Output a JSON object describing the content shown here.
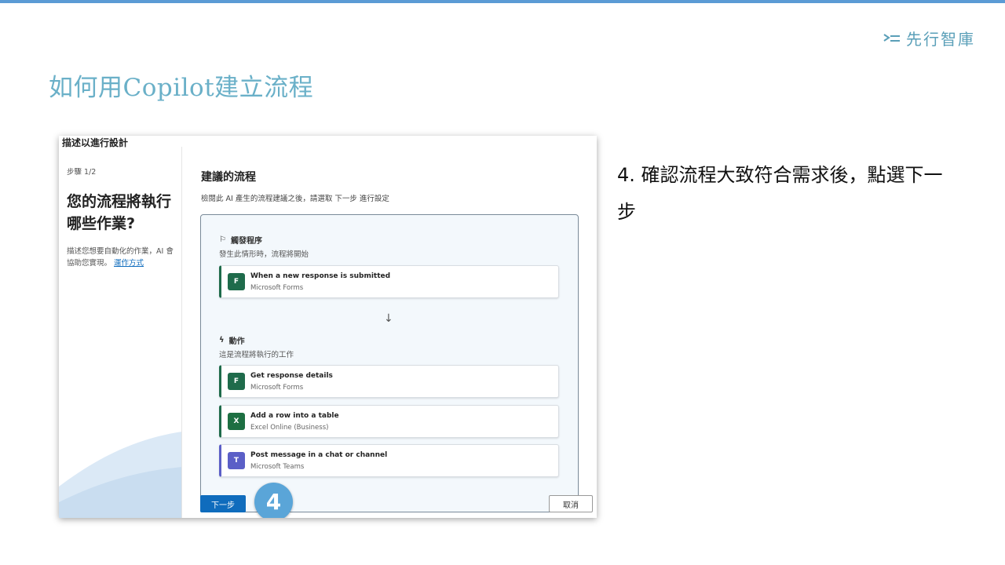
{
  "brand": {
    "name": "先行智庫"
  },
  "slide": {
    "title": "如何用Copilot建立流程"
  },
  "screenshot": {
    "header": "描述以進行設計",
    "left": {
      "step": "步驟 1/2",
      "heading": "您的流程將執行哪些作業?",
      "desc": "描述您想要自動化的作業，AI 會協助您實現。",
      "link": "運作方式"
    },
    "right": {
      "title": "建議的流程",
      "subtitle": "檢閱此 AI 產生的流程建議之後，請選取 下一步 進行設定",
      "trigger": {
        "heading": "觸發程序",
        "sub": "發生此情形時，流程將開始",
        "card": {
          "title": "When a new response is submitted",
          "app": "Microsoft Forms",
          "icon": "forms-icon"
        }
      },
      "actions": {
        "heading": "動作",
        "sub": "這是流程將執行的工作",
        "cards": [
          {
            "title": "Get response details",
            "app": "Microsoft Forms",
            "icon": "forms-icon",
            "color": "#1f6b4b"
          },
          {
            "title": "Add a row into a table",
            "app": "Excel Online (Business)",
            "icon": "excel-icon",
            "color": "#1d6f42"
          },
          {
            "title": "Post message in a chat or channel",
            "app": "Microsoft Teams",
            "icon": "teams-icon",
            "color": "#5b5fc7"
          }
        ]
      }
    },
    "next_button": "下一步",
    "cancel_button": "取消",
    "badge": "4"
  },
  "instruction": "4. 確認流程大致符合需求後，點選下一步",
  "colors": {
    "accent": "#5b9bd5",
    "title": "#6ab0c8",
    "primary": "#0f6cbd"
  }
}
